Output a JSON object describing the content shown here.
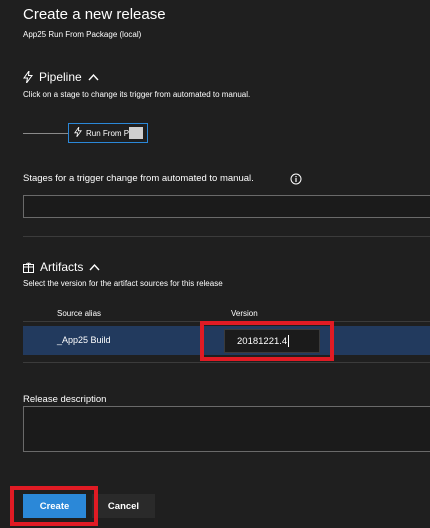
{
  "panel": {
    "title": "Create a new release",
    "subtitle": "App25 Run From Package (local)"
  },
  "pipeline": {
    "heading": "Pipeline",
    "help": "Click on a stage to change its trigger from automated to manual.",
    "stage_label": "Run From Pa"
  },
  "stages_trigger": {
    "label": "Stages for a trigger change from automated to manual.",
    "value": ""
  },
  "artifacts": {
    "heading": "Artifacts",
    "help": "Select the version for the artifact sources for this release",
    "columns": [
      "Source alias",
      "Version"
    ],
    "rows": [
      {
        "alias": "_App25 Build",
        "version": "20181221.4"
      }
    ]
  },
  "release_description": {
    "label": "Release description",
    "value": ""
  },
  "footer": {
    "create_label": "Create",
    "cancel_label": "Cancel"
  },
  "colors": {
    "background": "#1f1f1f",
    "accent": "#2b88d8",
    "selected_row": "#223a5e",
    "highlight": "#e01b24"
  }
}
